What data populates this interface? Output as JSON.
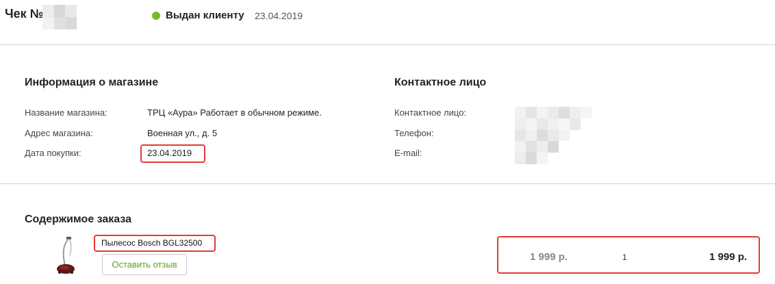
{
  "header": {
    "receipt_title": "Чек №",
    "status_text": "Выдан клиенту",
    "status_date": "23.04.2019",
    "status_color": "#7cb82f"
  },
  "store_info": {
    "title": "Информация о магазине",
    "name_label": "Название магазина:",
    "name_value": "ТРЦ «Аура» Работает в обычном режиме.",
    "address_label": "Адрес магазина:",
    "address_value": "Военная ул., д. 5",
    "date_label": "Дата покупки:",
    "date_value": "23.04.2019"
  },
  "contact": {
    "title": "Контактное лицо",
    "person_label": "Контактное лицо:",
    "phone_label": "Телефон:",
    "email_label": "E-mail:"
  },
  "order": {
    "title": "Содержимое заказа",
    "item": {
      "name": "Пылесос Bosch BGL32500",
      "review_button": "Оставить отзыв",
      "unit_price": "1 999 р.",
      "quantity": "1",
      "total_price": "1 999 р."
    }
  },
  "colors": {
    "highlight": "#e53935",
    "accent_green": "#5aa516",
    "divider": "#d2d2d2"
  }
}
